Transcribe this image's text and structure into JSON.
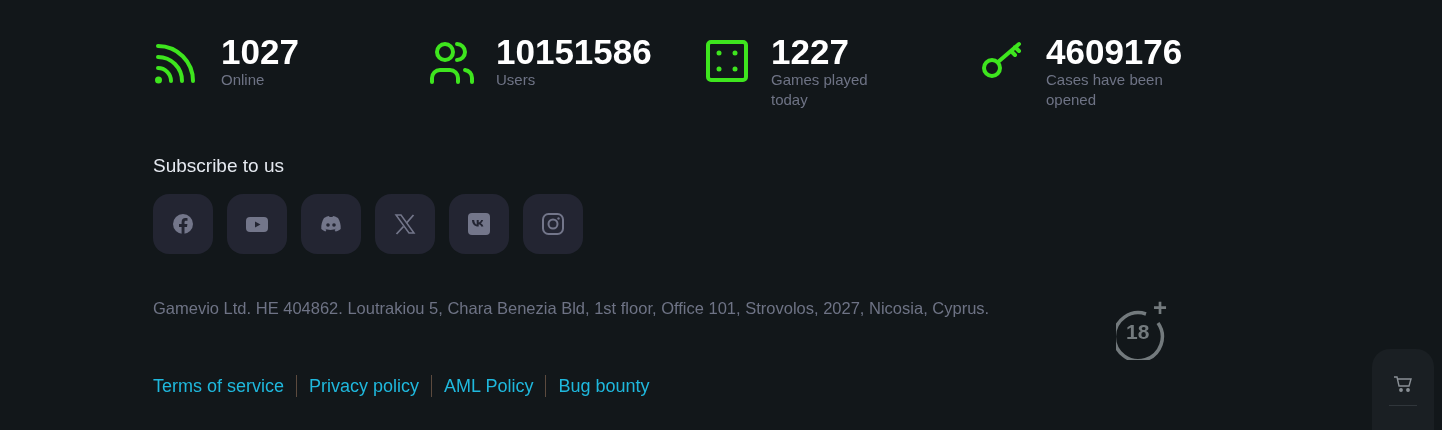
{
  "stats": [
    {
      "kind": "online",
      "value": "1027",
      "label": "Online"
    },
    {
      "kind": "users",
      "value": "10151586",
      "label": "Users"
    },
    {
      "kind": "games",
      "value": "1227",
      "label": "Games played today"
    },
    {
      "kind": "cases",
      "value": "4609176",
      "label": "Cases have been opened"
    }
  ],
  "subscribe": {
    "title": "Subscribe to us",
    "networks": [
      {
        "kind": "facebook"
      },
      {
        "kind": "youtube"
      },
      {
        "kind": "discord"
      },
      {
        "kind": "x"
      },
      {
        "kind": "vk"
      },
      {
        "kind": "instagram"
      }
    ]
  },
  "address": "Gamevio Ltd. HE 404862. Loutrakiou 5, Chara Benezia Bld, 1st floor, Office 101, Strovolos, 2027, Nicosia, Cyprus.",
  "links": [
    "Terms of service",
    "Privacy policy",
    "AML Policy",
    "Bug bounty"
  ],
  "age_badge": {
    "number": "18",
    "sign": "+"
  }
}
